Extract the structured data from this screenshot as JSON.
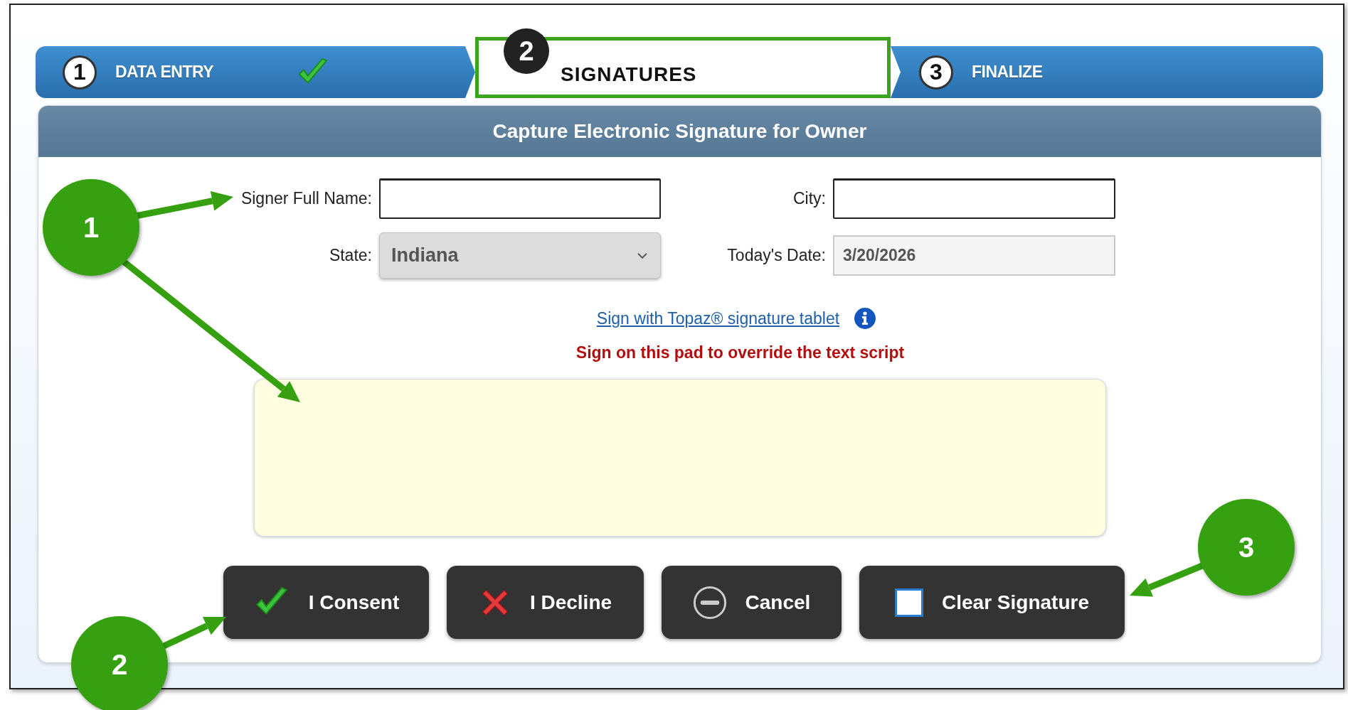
{
  "steps": [
    {
      "number": "1",
      "label": "DATA ENTRY",
      "completed": true,
      "selected": false
    },
    {
      "number": "2",
      "label": "SIGNATURES",
      "completed": false,
      "selected": true
    },
    {
      "number": "3",
      "label": "FINALIZE",
      "completed": false,
      "selected": false
    }
  ],
  "panel": {
    "title": "Capture Electronic Signature for Owner"
  },
  "fields": [
    {
      "kind": "text",
      "label": "Signer Full Name:"
    },
    {
      "kind": "text",
      "label": "City:"
    },
    {
      "kind": "select",
      "label": "State:",
      "value": "Indiana"
    },
    {
      "kind": "readonly",
      "label": "Today's Date:",
      "value": "3/20/2026"
    }
  ],
  "tablet_link": "Sign with Topaz® signature tablet",
  "pad_notice": "Sign on this pad to override the text script",
  "buttons": [
    {
      "kind": "consent",
      "label": "I Consent"
    },
    {
      "kind": "decline",
      "label": "I Decline"
    },
    {
      "kind": "cancel",
      "label": "Cancel"
    },
    {
      "kind": "clear",
      "label": "Clear Signature"
    }
  ],
  "callouts": [
    {
      "number": "1"
    },
    {
      "number": "2"
    },
    {
      "number": "3"
    }
  ]
}
